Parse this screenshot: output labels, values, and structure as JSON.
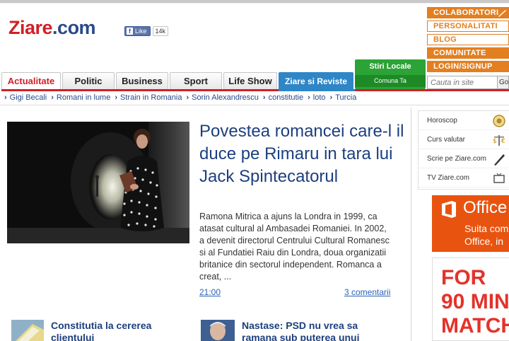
{
  "logo": {
    "brand": "Ziare",
    "tld": ".com"
  },
  "facebook": {
    "like_label": "Like",
    "count": "14k",
    "fb_letter": "f"
  },
  "right_menu": [
    {
      "label": "COLABORATORI",
      "style": "fill"
    },
    {
      "label": "PERSONALITATI",
      "style": "out"
    },
    {
      "label": "BLOG",
      "style": "out"
    },
    {
      "label": "COMUNITATE",
      "style": "fill"
    },
    {
      "label": "LOGIN/SIGNUP",
      "style": "fill"
    }
  ],
  "tabs": [
    "Actualitate",
    "Politic",
    "Business",
    "Sport",
    "Life Show",
    "Ziare si Reviste"
  ],
  "stiri_locale": {
    "title": "Stiri Locale",
    "subtitle": "Comuna Ta"
  },
  "search": {
    "placeholder": "Cauta in site",
    "button": "Go"
  },
  "subnav": [
    "Gigi Becali",
    "Romani in lume",
    "Strain in Romania",
    "Sorin Alexandrescu",
    "constitutie",
    "loto",
    "Turcia"
  ],
  "main_story": {
    "headline": "Povestea romancei care-l il duce pe Rimaru in tara lui Jack Spintecatorul",
    "summary": "Ramona Mitrica a ajuns la Londra in 1999, ca atasat cultural al Ambasadei Romaniei. In 2002, a devenit directorul Centrului Cultural Romanesc si al Fundatiei Raiu din Londra, doua organizatii britanice din sectorul independent. Romanca a creat, ...",
    "time": "21:00",
    "comments": "3 comentarii"
  },
  "stories": [
    {
      "line1": "Constitutia la cererea",
      "line2": "clientului"
    },
    {
      "line1": "Nastase: PSD nu vrea sa",
      "line2": "ramana sub puterea unui"
    }
  ],
  "widgets": [
    "Horoscop",
    "Curs valutar",
    "Scrie pe Ziare.com",
    "TV Ziare.com"
  ],
  "ads": {
    "office": {
      "title": "Office",
      "line1": "Suita com",
      "line2": "Office, in"
    },
    "match": {
      "lines": [
        "FOR",
        "90 MIN",
        "MATCHI"
      ]
    }
  },
  "colors": {
    "brand_red": "#d21f26",
    "brand_blue": "#2a4a8a",
    "orange": "#e37f20",
    "green": "#2ca336",
    "link": "#2a63b8"
  }
}
